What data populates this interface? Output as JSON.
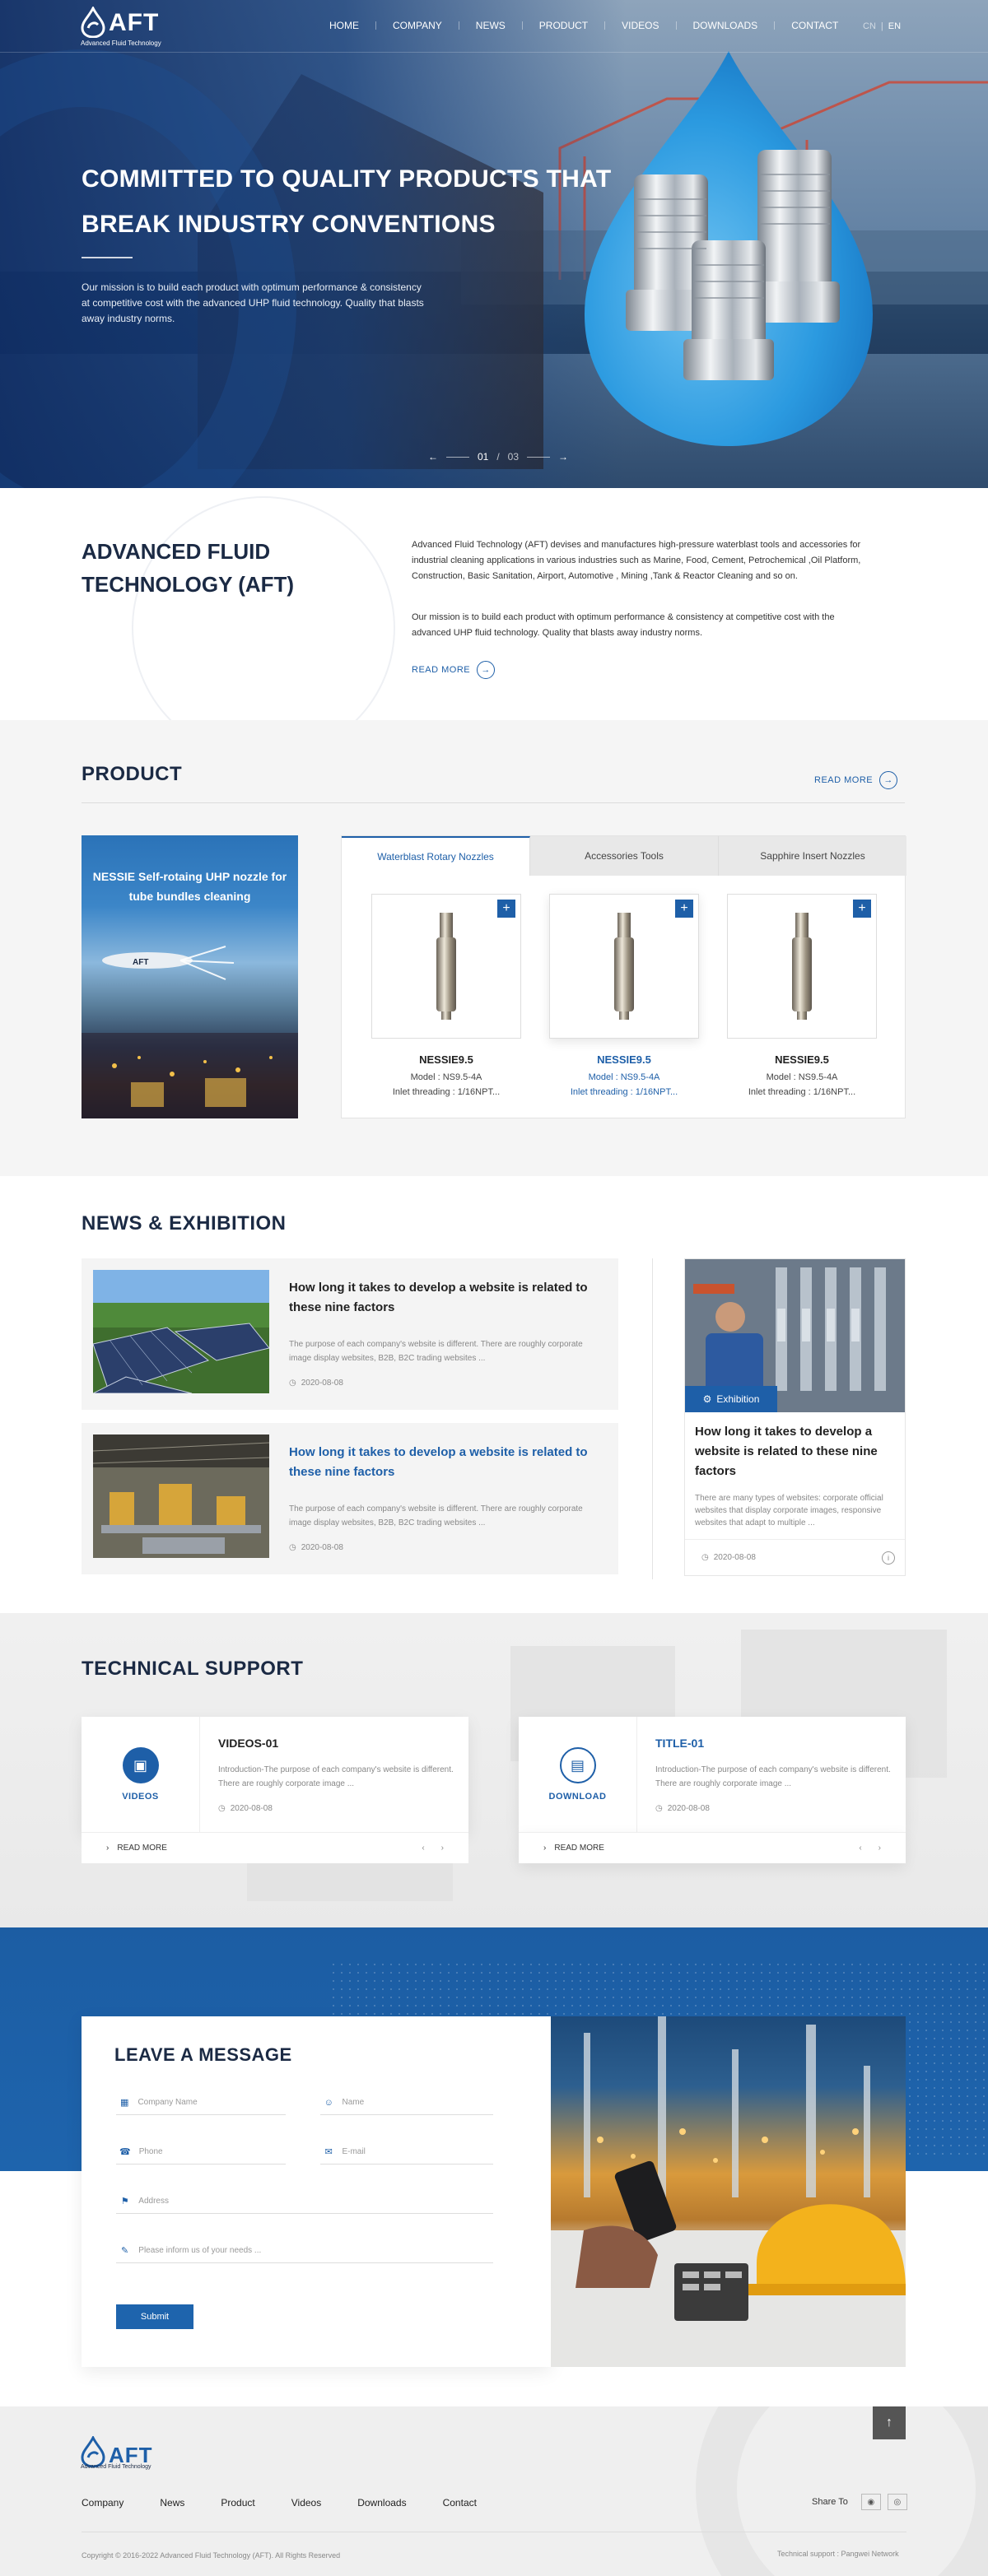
{
  "header": {
    "logo": "AFT",
    "logo_sub": "Advanced Fluid Technology",
    "nav": [
      "HOME",
      "COMPANY",
      "NEWS",
      "PRODUCT",
      "VIDEOS",
      "DOWNLOADS",
      "CONTACT"
    ],
    "lang_cn": "CN",
    "lang_sep": "|",
    "lang_en": "EN"
  },
  "hero": {
    "title": "COMMITTED TO QUALITY PRODUCTS THAT BREAK INDUSTRY CONVENTIONS",
    "desc": "Our mission is to build each product with optimum performance & consistency at competitive cost with the advanced UHP fluid technology. Quality that blasts away industry norms.",
    "slide_current": "01",
    "slide_sep": "/",
    "slide_total": "03"
  },
  "about": {
    "title": "ADVANCED FLUID TECHNOLOGY (AFT)",
    "p1": "Advanced Fluid Technology (AFT) devises and manufactures high-pressure waterblast tools and accessories for industrial cleaning applications in various industries such as Marine, Food, Cement, Petrochemical ,Oil Platform, Construction, Basic Sanitation, Airport, Automotive , Mining ,Tank & Reactor Cleaning and so on.",
    "p2": "Our mission is to build each product with optimum performance & consistency at competitive cost with the advanced UHP fluid technology. Quality that blasts away industry norms.",
    "read_more": "READ  MORE"
  },
  "product": {
    "title": "PRODUCT",
    "read_more": "READ  MORE",
    "feature_title": "NESSIE Self-rotaing UHP nozzle for tube bundles cleaning",
    "feature_brand": "AFT",
    "tabs": [
      "Waterblast Rotary Nozzles",
      "Accessories Tools",
      "Sapphire Insert Nozzles"
    ],
    "cards": [
      {
        "name": "NESSIE9.5",
        "model": "Model : NS9.5-4A",
        "thread": "Inlet threading : 1/16NPT..."
      },
      {
        "name": "NESSIE9.5",
        "model": "Model : NS9.5-4A",
        "thread": "Inlet threading : 1/16NPT..."
      },
      {
        "name": "NESSIE9.5",
        "model": "Model : NS9.5-4A",
        "thread": "Inlet threading : 1/16NPT..."
      }
    ],
    "plus": "+"
  },
  "news": {
    "title": "NEWS & EXHIBITION",
    "items": [
      {
        "title": "How long it takes to develop a website is related to these nine factors",
        "summary": "The purpose of each company's website is different. There are roughly corporate image display websites, B2B, B2C trading websites  ...",
        "date": "2020-08-08"
      },
      {
        "title": "How long it takes to develop a website is related to these nine factors",
        "summary": "The purpose of each company's website is different. There are roughly corporate image display websites, B2B, B2C trading websites  ...",
        "date": "2020-08-08"
      }
    ],
    "side": {
      "badge": "Exhibition",
      "title": "How long it takes to develop a website is related to these nine factors",
      "summary": "There are many types of websites: corporate official websites that display corporate images, responsive websites that adapt to multiple ...",
      "date": "2020-08-08"
    }
  },
  "tech": {
    "title": "TECHNICAL SUPPORT",
    "cards": [
      {
        "label": "VIDEOS",
        "title": "VIDEOS-01",
        "summary": "Introduction-The purpose of each company's website is different. There are roughly corporate image  ...",
        "date": "2020-08-08",
        "read_more": "READ  MORE"
      },
      {
        "label": "DOWNLOAD",
        "title": "TITLE-01",
        "summary": "Introduction-The purpose of each company's website is different. There are roughly corporate image  ...",
        "date": "2020-08-08",
        "read_more": "READ  MORE"
      }
    ]
  },
  "message": {
    "title": "LEAVE A MESSAGE",
    "placeholders": {
      "company": "Company Name",
      "name": "Name",
      "phone": "Phone",
      "email": "E-mail",
      "address": "Address",
      "needs": "Please inform us of your needs ..."
    },
    "submit": "Submit"
  },
  "footer": {
    "logo": "AFT",
    "logo_sub": "Advanced Fluid Technology",
    "nav": [
      "Company",
      "News",
      "Product",
      "Videos",
      "Downloads",
      "Contact"
    ],
    "share_label": "Share To",
    "copyright": "Copyright © 2016-2022 Advanced Fluid Technology (AFT). All Rights Reserved",
    "tech_support": "Technical support : Pangwei Network"
  },
  "colors": {
    "brand_blue": "#1e5fa8",
    "dark_navy": "#1b2a44"
  },
  "icons": [
    "logo-drop-icon",
    "arrow-left-icon",
    "arrow-right-icon",
    "circle-arrow-icon",
    "plus-icon",
    "clock-icon",
    "exhibition-icon",
    "info-icon",
    "video-icon",
    "document-icon",
    "chevron-left-icon",
    "chevron-right-icon",
    "building-icon",
    "user-icon",
    "phone-icon",
    "mail-icon",
    "location-icon",
    "edit-icon",
    "wechat-icon",
    "weibo-icon",
    "arrow-up-icon"
  ]
}
